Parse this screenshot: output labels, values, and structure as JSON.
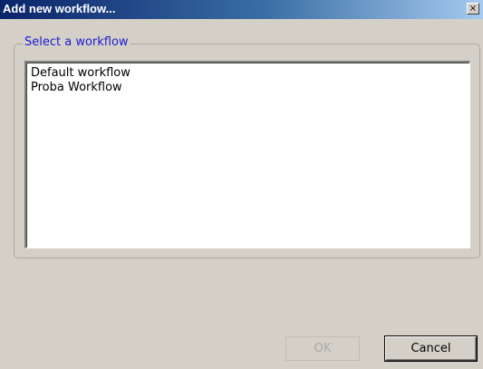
{
  "window": {
    "title": "Add new workflow...",
    "close_symbol": "×"
  },
  "group": {
    "legend": "Select a workflow"
  },
  "workflows": [
    "Default workflow",
    "Proba Workflow"
  ],
  "buttons": {
    "ok": "OK",
    "cancel": "Cancel",
    "ok_enabled": false
  },
  "colors": {
    "title_bar_start": "#0a246a",
    "title_bar_end": "#a6caf0",
    "legend_text": "#1b1bd0",
    "dialog_background": "#d4d0c8"
  },
  "icons": {
    "close": "close-icon"
  }
}
